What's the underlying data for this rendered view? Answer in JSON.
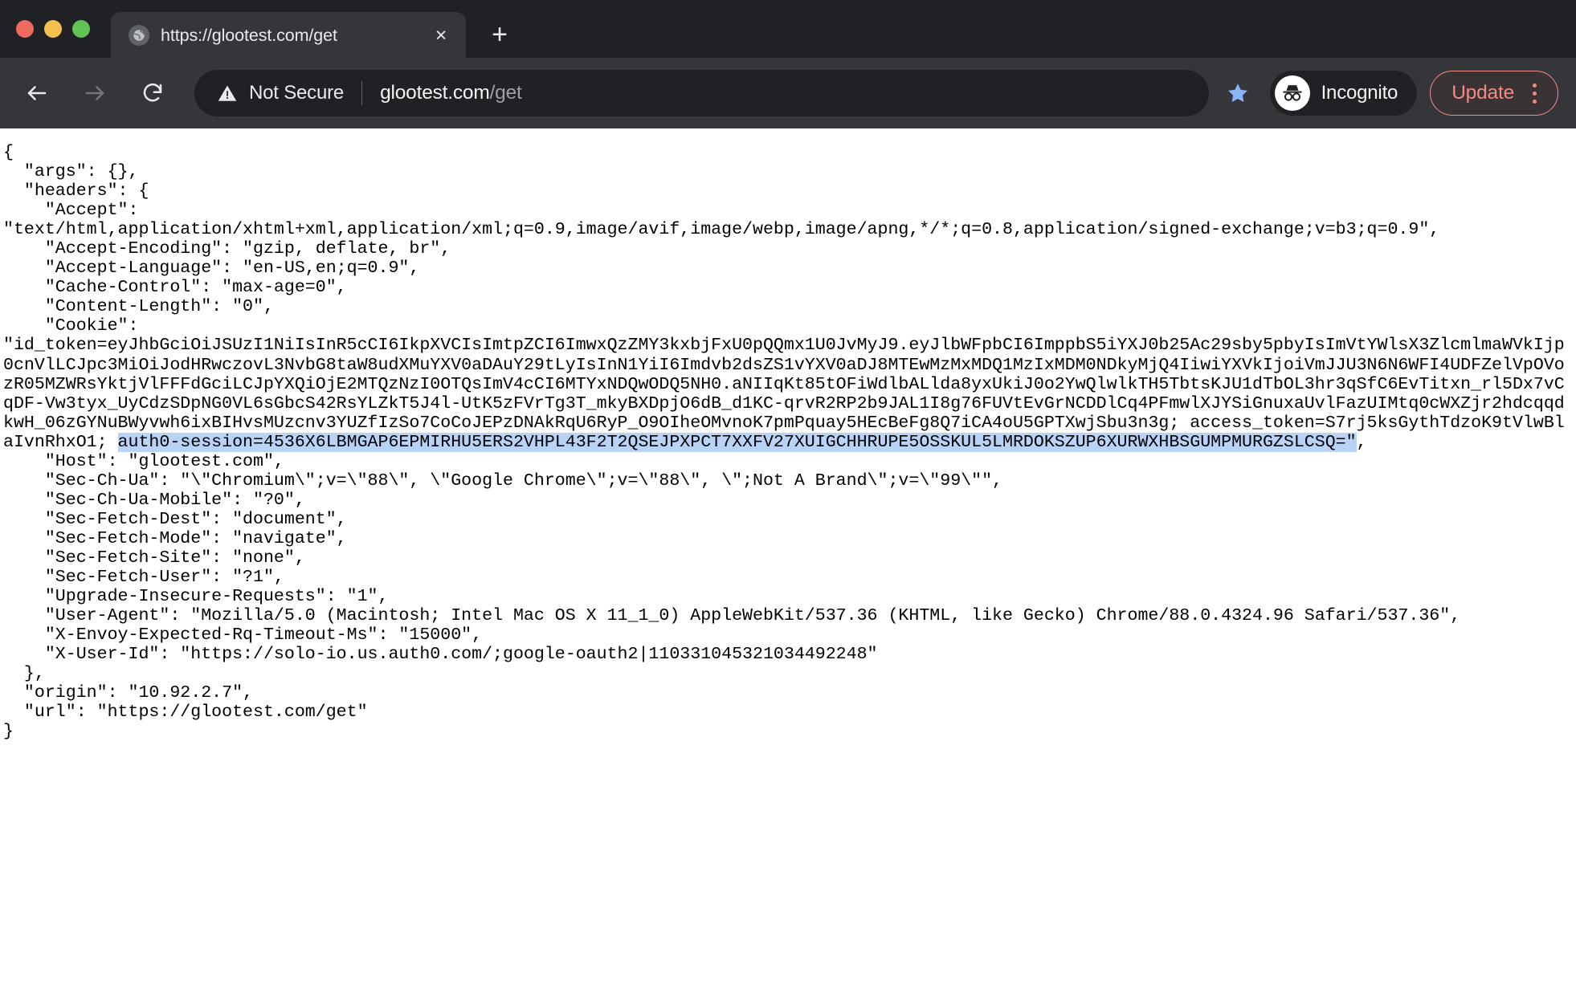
{
  "window": {
    "traffic_lights": [
      "close",
      "minimize",
      "maximize"
    ]
  },
  "tab": {
    "title": "https://glootest.com/get",
    "favicon": "globe-icon",
    "close_label": "×",
    "new_tab_label": "+"
  },
  "toolbar": {
    "back_label": "←",
    "forward_label": "→",
    "reload_label": "↻",
    "security_text": "Not Secure",
    "url_host": "glootest.com",
    "url_path": "/get",
    "bookmark_icon": "star-icon",
    "profile_label": "Incognito",
    "profile_icon": "incognito-icon",
    "update_label": "Update",
    "menu_icon": "kebab-menu-icon"
  },
  "page": {
    "line_01": "{",
    "line_02": "  \"args\": {},",
    "line_03": "  \"headers\": {",
    "line_04": "    \"Accept\": ",
    "line_05": "\"text/html,application/xhtml+xml,application/xml;q=0.9,image/avif,image/webp,image/apng,*/*;q=0.8,application/signed-exchange;v=b3;q=0.9\",",
    "line_06": "    \"Accept-Encoding\": \"gzip, deflate, br\",",
    "line_07": "    \"Accept-Language\": \"en-US,en;q=0.9\",",
    "line_08": "    \"Cache-Control\": \"max-age=0\",",
    "line_09": "    \"Content-Length\": \"0\",",
    "line_10": "    \"Cookie\": ",
    "cookie_prefix": "\"id_token=eyJhbGciOiJSUzI1NiIsInR5cCI6IkpXVCIsImtpZCI6ImwxQzZMY3kxbjFxU0pQQmx1U0JvMyJ9.eyJlbWFpbCI6ImppbS5iYXJ0b25Ac29sby5pbyIsImVtYWlsX3ZlcmlmaWVkIjp0cnVlLCJpc3MiOiJodHRwczovL3NvbG8taW8udXMuYXV0aDAuY29tLyIsInN1YiI6Imdvb2dsZS1vYXV0aDJ8MTEwMzMxMDQ1MzIxMDM0NDkyMjQ4IiwiYXVkIjoiVmJJU3N6N6WFI4UDFZelVpOVozR05MZWRsYktjVlFFFdGciLCJpYXQiOjE2MTQzNzI0OTQsImV4cCI6MTYxNDQwODQ5NH0.aNIIqKt85tOFiWdlbALlda8yxUkiJ0o2YwQlwlkTH5TbtsKJU1dTbOL3hr3qSfC6EvTitxn_rl5Dx7vCqDF-Vw3tyx_UyCdzSDpNG0VL6sGbcS42RsYLZkT5J4l-UtK5zFVrTg3T_mkyBXDpjO6dB_d1KC-qrvR2RP2b9JAL1I8g76FUVtEvGrNCDDlCq4PFmwlXJYSiGnuxaUvlFazUIMtq0cWXZjr2hdcqqdkwH_06zGYNuBWyvwh6ixBIHvsMUzcnv3YUZfIzSo7CoCoJEPzDNAkRqU6RyP_O9OIheOMvnoK7pmPquay5HEcBeFg8Q7iCA4oU5GPTXwjSbu3n3g; access_token=S7rj5ksGythTdzoK9tVlwBlaIvnRhxO1; ",
    "cookie_selected": "auth0-session=4536X6LBMGAP6EPMIRHU5ERS2VHPL43F2T2QSEJPXPCT7XXFV27XUIGCHHRUPE5OSSKUL5LMRDOKSZUP6XURWXHBSGUMPMURGZSLCSQ=\"",
    "cookie_suffix": ",",
    "line_11": "    \"Host\": \"glootest.com\",",
    "line_12": "    \"Sec-Ch-Ua\": \"\\\"Chromium\\\";v=\\\"88\\\", \\\"Google Chrome\\\";v=\\\"88\\\", \\\";Not A Brand\\\";v=\\\"99\\\"\",",
    "line_13": "    \"Sec-Ch-Ua-Mobile\": \"?0\",",
    "line_14": "    \"Sec-Fetch-Dest\": \"document\",",
    "line_15": "    \"Sec-Fetch-Mode\": \"navigate\",",
    "line_16": "    \"Sec-Fetch-Site\": \"none\",",
    "line_17": "    \"Sec-Fetch-User\": \"?1\",",
    "line_18": "    \"Upgrade-Insecure-Requests\": \"1\",",
    "line_19": "    \"User-Agent\": \"Mozilla/5.0 (Macintosh; Intel Mac OS X 11_1_0) AppleWebKit/537.36 (KHTML, like Gecko) Chrome/88.0.4324.96 Safari/537.36\",",
    "line_20": "    \"X-Envoy-Expected-Rq-Timeout-Ms\": \"15000\",",
    "line_21": "    \"X-User-Id\": \"https://solo-io.us.auth0.com/;google-oauth2|110331045321034492248\"",
    "line_22": "  },",
    "line_23": "  \"origin\": \"10.92.2.7\",",
    "line_24": "  \"url\": \"https://glootest.com/get\"",
    "line_25": "}"
  },
  "colors": {
    "chrome_dark": "#35363a",
    "tabstrip_dark": "#202124",
    "accent_update": "#f28b82",
    "selection": "#b9d3f7",
    "bookmark_star": "#8ab4f8"
  }
}
